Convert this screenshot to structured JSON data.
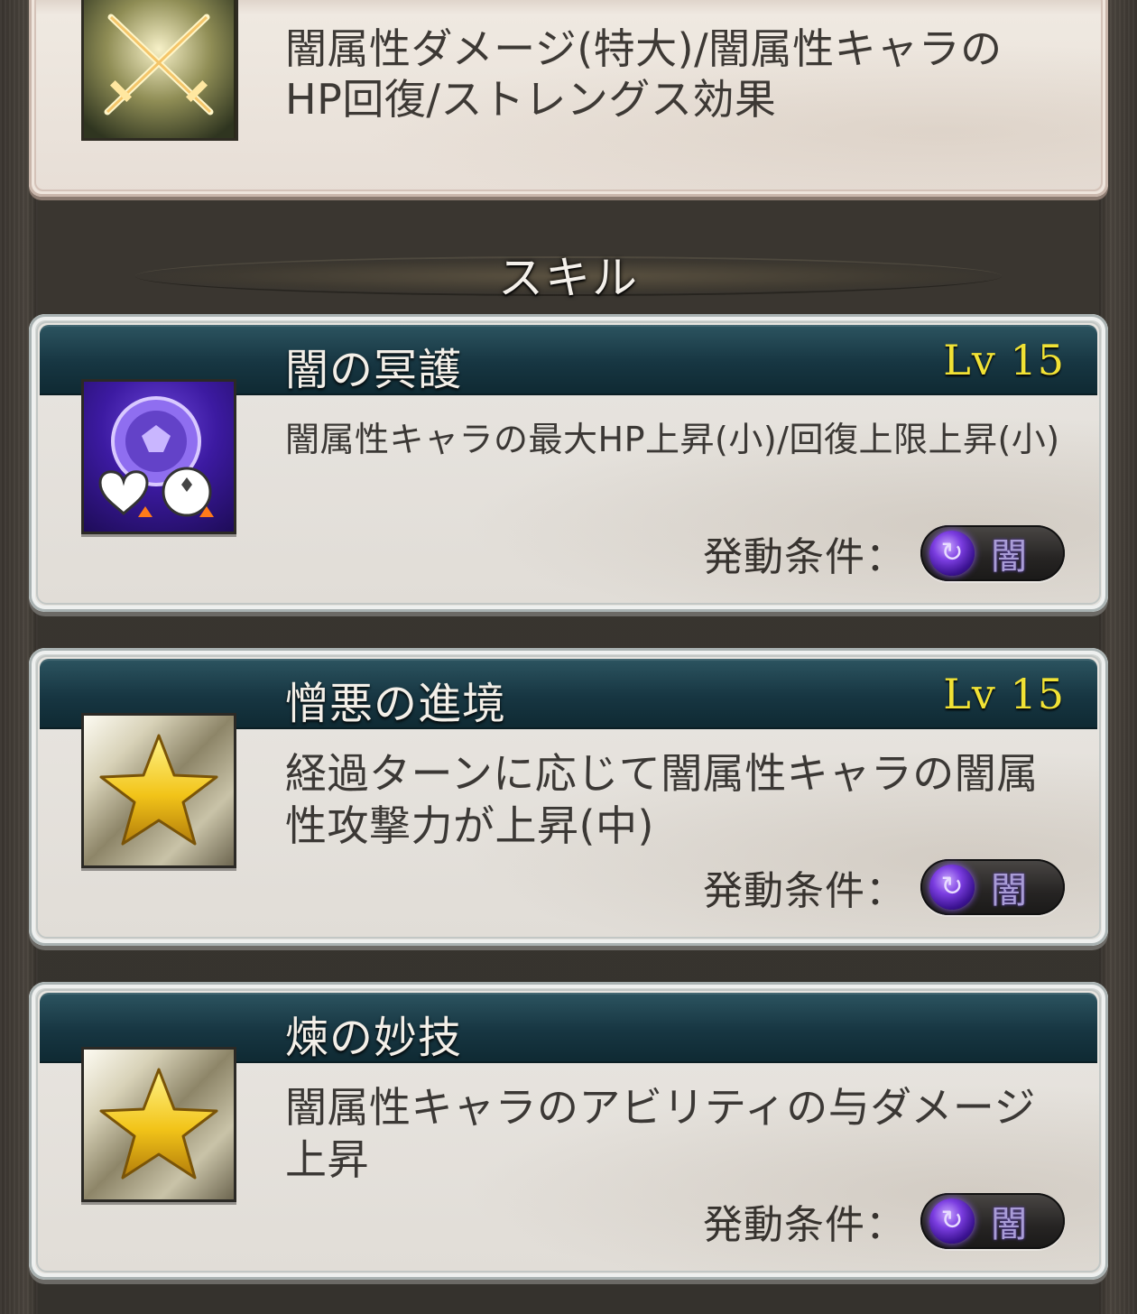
{
  "top_card": {
    "description": "闇属性ダメージ(特大)/闇属性キャラのHP回復/ストレングス効果",
    "icon": "crossed-swords-icon"
  },
  "section": {
    "title": "スキル"
  },
  "condition_label": "発動条件：",
  "element_label": "闇",
  "skills": [
    {
      "name": "闇の冥護",
      "level": "Lv 15",
      "description": "闇属性キャラの最大HP上昇(小)/回復上限上昇(小)",
      "icon": "dark-hp-up-icon"
    },
    {
      "name": "憎悪の進境",
      "level": "Lv 15",
      "description": "経過ターンに応じて闇属性キャラの闇属性攻撃力が上昇(中)",
      "icon": "star-icon"
    },
    {
      "name": "煉の妙技",
      "level": "",
      "description": "闇属性キャラのアビリティの与ダメージ上昇",
      "icon": "star-icon"
    }
  ]
}
